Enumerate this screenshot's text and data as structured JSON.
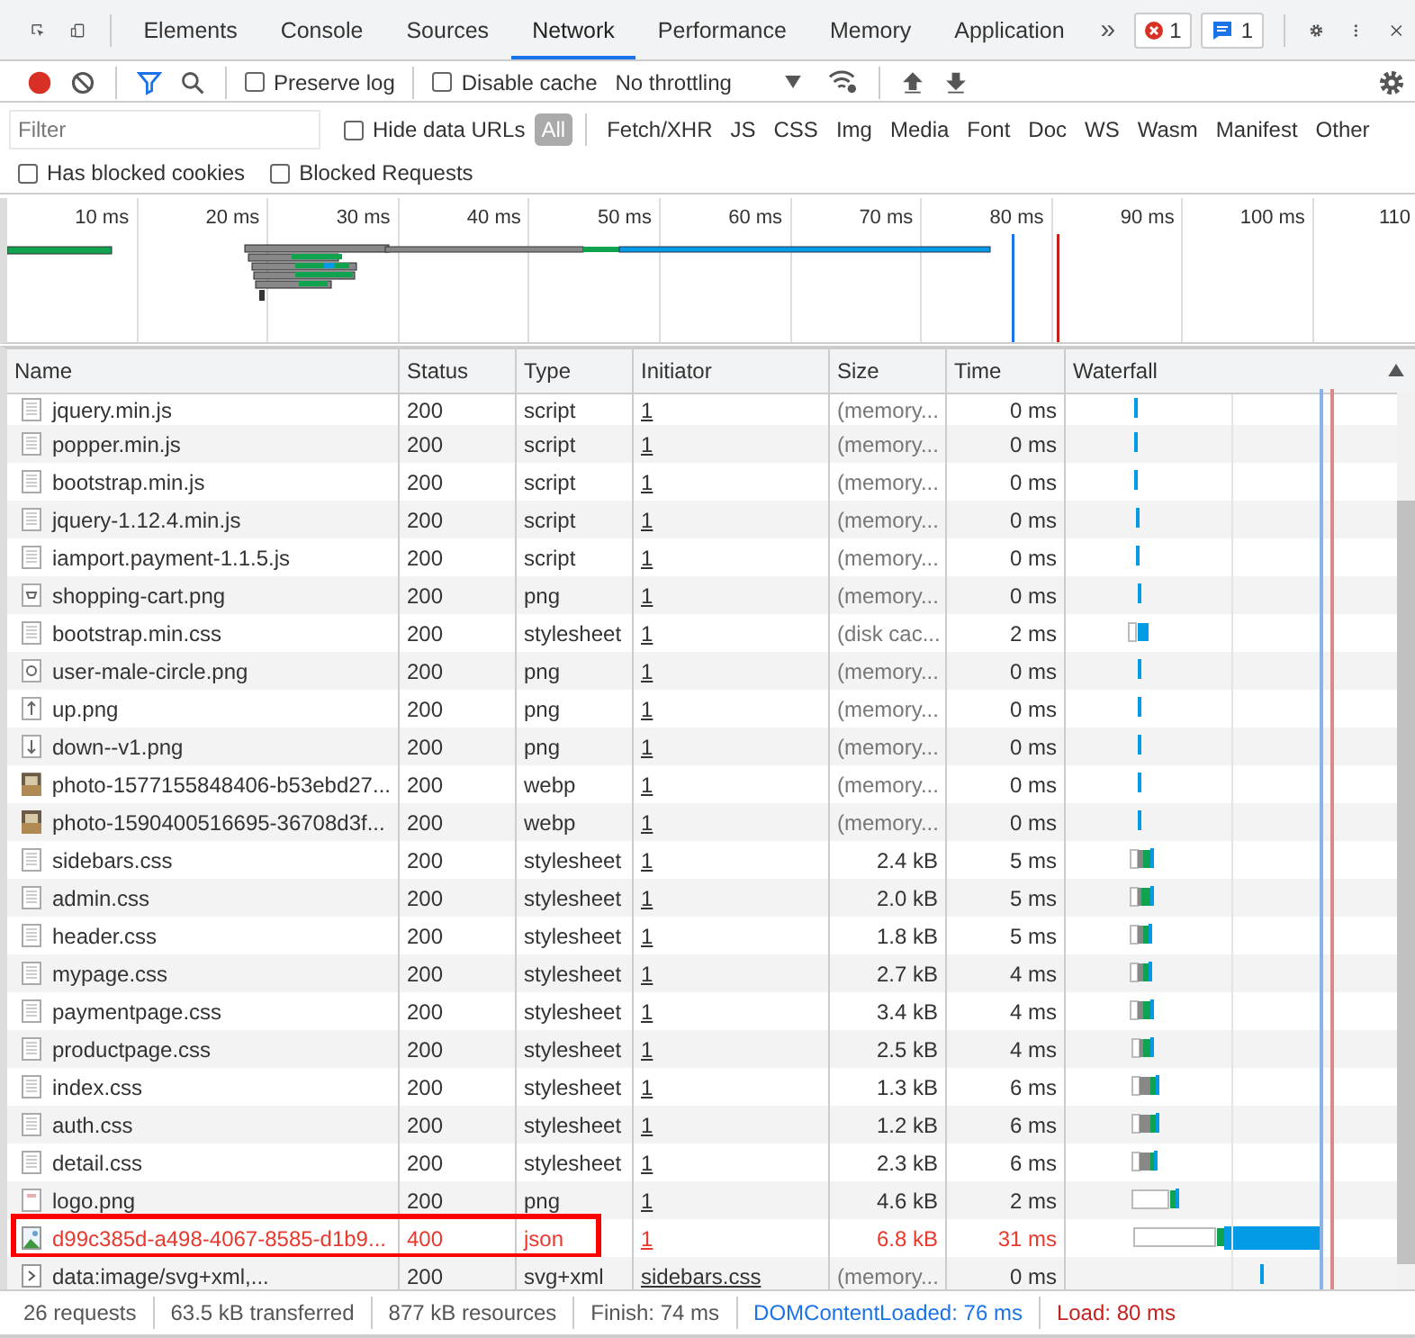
{
  "main_tabs": [
    {
      "label": "Elements",
      "selected": false
    },
    {
      "label": "Console",
      "selected": false
    },
    {
      "label": "Sources",
      "selected": false
    },
    {
      "label": "Network",
      "selected": true
    },
    {
      "label": "Performance",
      "selected": false
    },
    {
      "label": "Memory",
      "selected": false
    },
    {
      "label": "Application",
      "selected": false
    }
  ],
  "more_tabs": "»",
  "error_count": "1",
  "message_count": "1",
  "toolbar": {
    "recording": true,
    "filter_active": true,
    "preserve_log": {
      "label": "Preserve log",
      "checked": false
    },
    "disable_cache": {
      "label": "Disable cache",
      "checked": false
    },
    "throttling": "No throttling"
  },
  "filter_bar": {
    "placeholder": "Filter",
    "hide_data_urls": {
      "label": "Hide data URLs",
      "checked": false
    },
    "types": [
      {
        "label": "All",
        "selected": true
      },
      {
        "label": "Fetch/XHR",
        "selected": false
      },
      {
        "label": "JS",
        "selected": false
      },
      {
        "label": "CSS",
        "selected": false
      },
      {
        "label": "Img",
        "selected": false
      },
      {
        "label": "Media",
        "selected": false
      },
      {
        "label": "Font",
        "selected": false
      },
      {
        "label": "Doc",
        "selected": false
      },
      {
        "label": "WS",
        "selected": false
      },
      {
        "label": "Wasm",
        "selected": false
      },
      {
        "label": "Manifest",
        "selected": false
      },
      {
        "label": "Other",
        "selected": false
      }
    ],
    "blocked": [
      {
        "label": "Has blocked cookies",
        "checked": false
      },
      {
        "label": "Blocked Requests",
        "checked": false
      }
    ]
  },
  "overview_ticks": [
    "10 ms",
    "20 ms",
    "30 ms",
    "40 ms",
    "50 ms",
    "60 ms",
    "70 ms",
    "80 ms",
    "90 ms",
    "100 ms",
    "110"
  ],
  "table": {
    "columns": [
      "Name",
      "Status",
      "Type",
      "Initiator",
      "Size",
      "Time",
      "Waterfall"
    ],
    "rows": [
      {
        "name": "jquery.min.js",
        "kind": "doc",
        "status": "200",
        "type": "script",
        "initiator": "1",
        "size": "(memory...",
        "time": "0 ms",
        "error": false,
        "outlined": false
      },
      {
        "name": "popper.min.js",
        "kind": "doc",
        "status": "200",
        "type": "script",
        "initiator": "1",
        "size": "(memory...",
        "time": "0 ms",
        "error": false,
        "outlined": false
      },
      {
        "name": "bootstrap.min.js",
        "kind": "doc",
        "status": "200",
        "type": "script",
        "initiator": "1",
        "size": "(memory...",
        "time": "0 ms",
        "error": false,
        "outlined": false
      },
      {
        "name": "jquery-1.12.4.min.js",
        "kind": "doc",
        "status": "200",
        "type": "script",
        "initiator": "1",
        "size": "(memory...",
        "time": "0 ms",
        "error": false,
        "outlined": false
      },
      {
        "name": "iamport.payment-1.1.5.js",
        "kind": "doc",
        "status": "200",
        "type": "script",
        "initiator": "1",
        "size": "(memory...",
        "time": "0 ms",
        "error": false,
        "outlined": false
      },
      {
        "name": "shopping-cart.png",
        "kind": "cart",
        "status": "200",
        "type": "png",
        "initiator": "1",
        "size": "(memory...",
        "time": "0 ms",
        "error": false,
        "outlined": false
      },
      {
        "name": "bootstrap.min.css",
        "kind": "doc",
        "status": "200",
        "type": "stylesheet",
        "initiator": "1",
        "size": "(disk cac...",
        "time": "2 ms",
        "error": false,
        "outlined": false
      },
      {
        "name": "user-male-circle.png",
        "kind": "user",
        "status": "200",
        "type": "png",
        "initiator": "1",
        "size": "(memory...",
        "time": "0 ms",
        "error": false,
        "outlined": false
      },
      {
        "name": "up.png",
        "kind": "up",
        "status": "200",
        "type": "png",
        "initiator": "1",
        "size": "(memory...",
        "time": "0 ms",
        "error": false,
        "outlined": false
      },
      {
        "name": "down--v1.png",
        "kind": "down",
        "status": "200",
        "type": "png",
        "initiator": "1",
        "size": "(memory...",
        "time": "0 ms",
        "error": false,
        "outlined": false
      },
      {
        "name": "photo-1577155848406-b53ebd27...",
        "status": "200",
        "type": "webp",
        "initiator": "1",
        "size": "(memory...",
        "time": "0 ms",
        "error": false,
        "outlined": false
      },
      {
        "name": "photo-1590400516695-36708d3f...",
        "status": "200",
        "type": "webp",
        "initiator": "1",
        "size": "(memory...",
        "time": "0 ms",
        "error": false,
        "outlined": false
      },
      {
        "name": "sidebars.css",
        "kind": "doc",
        "status": "200",
        "type": "stylesheet",
        "initiator": "1",
        "size": "2.4 kB",
        "time": "5 ms",
        "error": false,
        "outlined": false
      },
      {
        "name": "admin.css",
        "kind": "doc",
        "status": "200",
        "type": "stylesheet",
        "initiator": "1",
        "size": "2.0 kB",
        "time": "5 ms",
        "error": false,
        "outlined": false
      },
      {
        "name": "header.css",
        "kind": "doc",
        "status": "200",
        "type": "stylesheet",
        "initiator": "1",
        "size": "1.8 kB",
        "time": "5 ms",
        "error": false,
        "outlined": false
      },
      {
        "name": "mypage.css",
        "kind": "doc",
        "status": "200",
        "type": "stylesheet",
        "initiator": "1",
        "size": "2.7 kB",
        "time": "4 ms",
        "error": false,
        "outlined": false
      },
      {
        "name": "paymentpage.css",
        "kind": "doc",
        "status": "200",
        "type": "stylesheet",
        "initiator": "1",
        "size": "3.4 kB",
        "time": "4 ms",
        "error": false,
        "outlined": false
      },
      {
        "name": "productpage.css",
        "kind": "doc",
        "status": "200",
        "type": "stylesheet",
        "initiator": "1",
        "size": "2.5 kB",
        "time": "4 ms",
        "error": false,
        "outlined": false
      },
      {
        "name": "index.css",
        "kind": "doc",
        "status": "200",
        "type": "stylesheet",
        "initiator": "1",
        "size": "1.3 kB",
        "time": "6 ms",
        "error": false,
        "outlined": false
      },
      {
        "name": "auth.css",
        "kind": "doc",
        "status": "200",
        "type": "stylesheet",
        "initiator": "1",
        "size": "1.2 kB",
        "time": "6 ms",
        "error": false,
        "outlined": false
      },
      {
        "name": "detail.css",
        "kind": "doc",
        "status": "200",
        "type": "stylesheet",
        "initiator": "1",
        "size": "2.3 kB",
        "time": "6 ms",
        "error": false,
        "outlined": false
      },
      {
        "name": "logo.png",
        "kind": "logo",
        "status": "200",
        "type": "png",
        "initiator": "1",
        "size": "4.6 kB",
        "time": "2 ms",
        "error": false,
        "outlined": false
      },
      {
        "name": "d99c385d-a498-4067-8585-d1b9...",
        "status": "400",
        "type": "json",
        "initiator": "1",
        "size": "6.8 kB",
        "time": "31 ms",
        "error": true,
        "outlined": true
      },
      {
        "name": "data:image/svg+xml,...",
        "kind": "data",
        "status": "200",
        "type": "svg+xml",
        "initiator": "sidebars.css",
        "size": "(memory...",
        "time": "0 ms",
        "error": false,
        "outlined": false
      }
    ]
  },
  "status_bar": [
    {
      "text": "26 requests",
      "kind": "plain"
    },
    {
      "text": "63.5 kB transferred",
      "kind": "plain"
    },
    {
      "text": "877 kB resources",
      "kind": "plain"
    },
    {
      "text": "Finish: 74 ms",
      "kind": "plain"
    },
    {
      "text": "DOMContentLoaded: 76 ms",
      "kind": "dom"
    },
    {
      "text": "Load: 80 ms",
      "kind": "load"
    }
  ]
}
